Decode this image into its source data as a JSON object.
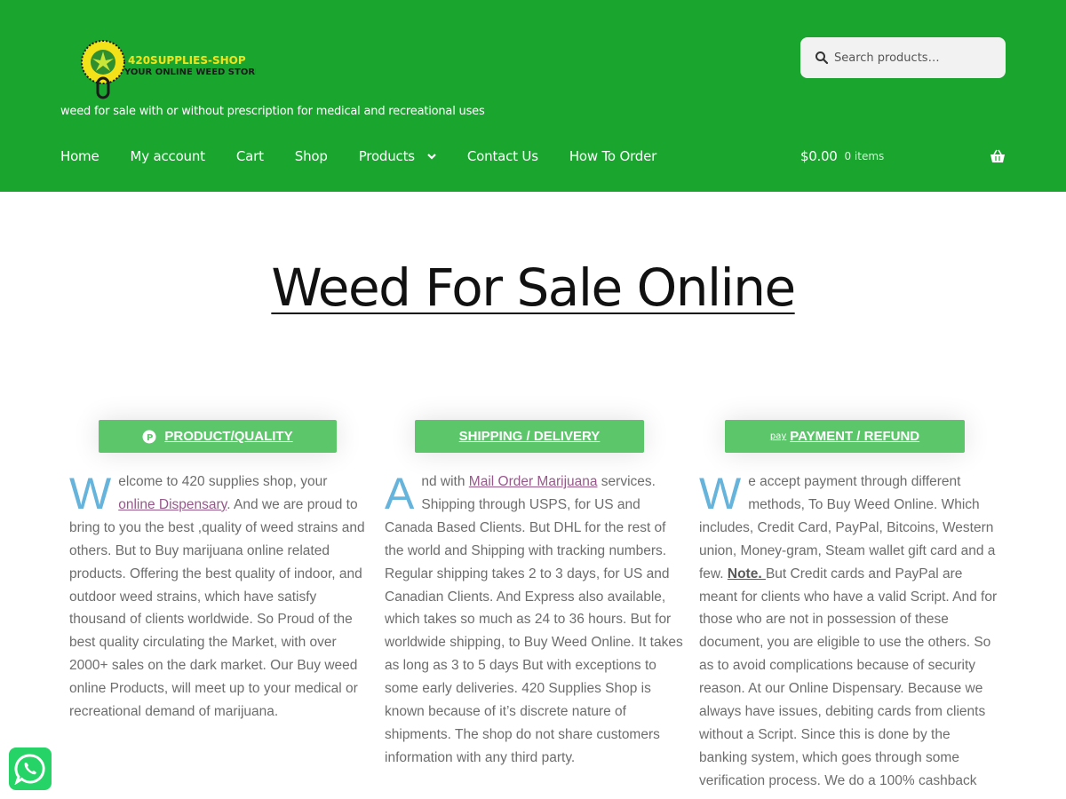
{
  "header": {
    "logo_top_text": "420SUPPLIES-SHOP",
    "logo_bottom_text": "YOUR ONLINE WEED STORE",
    "tagline": "weed for sale with or without prescription for medical and recreational uses",
    "search_placeholder": "Search products…",
    "nav": [
      "Home",
      "My account",
      "Cart",
      "Shop",
      "Products",
      "Contact Us",
      "How To Order"
    ],
    "cart_amount": "$0.00",
    "cart_count": "0 items"
  },
  "colors": {
    "header_bg": "#1aa52f",
    "button_bg": "#5cc66b",
    "dropcap": "#66b3dc",
    "link": "#96588a"
  },
  "title": "Weed For Sale Online",
  "columns": [
    {
      "button": "PRODUCT/QUALITY",
      "icon": "p-circle-icon",
      "dropcap": "W",
      "t1": "elcome to 420 supplies shop, your ",
      "link": "online Dispensary",
      "t2": ". And we are proud to bring to you the best ,quality of weed strains and others. But to Buy marijuana online related products. Offering the best quality of indoor, and outdoor weed strains, which have satisfy thousand of clients worldwide. So Proud of the best quality circulating the Market, with over 2000+ sales on the dark market. Our Buy weed online Products, will meet up to your medical or recreational demand of marijuana."
    },
    {
      "button": "SHIPPING / DELIVERY",
      "dropcap": "A",
      "t1": "nd with ",
      "link": "Mail Order Marijuana",
      "t2": " services. Shipping through USPS, for US and Canada Based Clients. But DHL for the rest of the world and Shipping with tracking numbers. Regular shipping takes 2 to 3 days, for US and Canadian Clients. And Express also available, which takes so much as 24 to 36 hours. But for worldwide shipping, to Buy Weed Online. It takes as long as 3 to 5 days But with exceptions to some early deliveries. 420 Supplies Shop is known because of it’s discrete nature of shipments. The shop do not share customers information with any third party."
    },
    {
      "button": "PAYMENT / REFUND",
      "icon": "amazon-pay-icon",
      "icon_text": "pay",
      "dropcap": "W",
      "t1": "e accept payment through different methods, To Buy Weed Online. Which includes, Credit Card, PayPal, Bitcoins, Western union, Money-gram, Steam wallet gift card and a few. ",
      "strong": "Note. ",
      "t2": "But Credit cards and PayPal are meant for clients who have a valid Script. And for those who are not in possession of these document, you are eligible to use the others. So as to avoid complications because of security reason. At our Online Dispensary. Because we always have issues, debiting cards from clients without a Script. Since this is done by the banking system, which goes through some verification process. We do a 100% cashback"
    }
  ]
}
